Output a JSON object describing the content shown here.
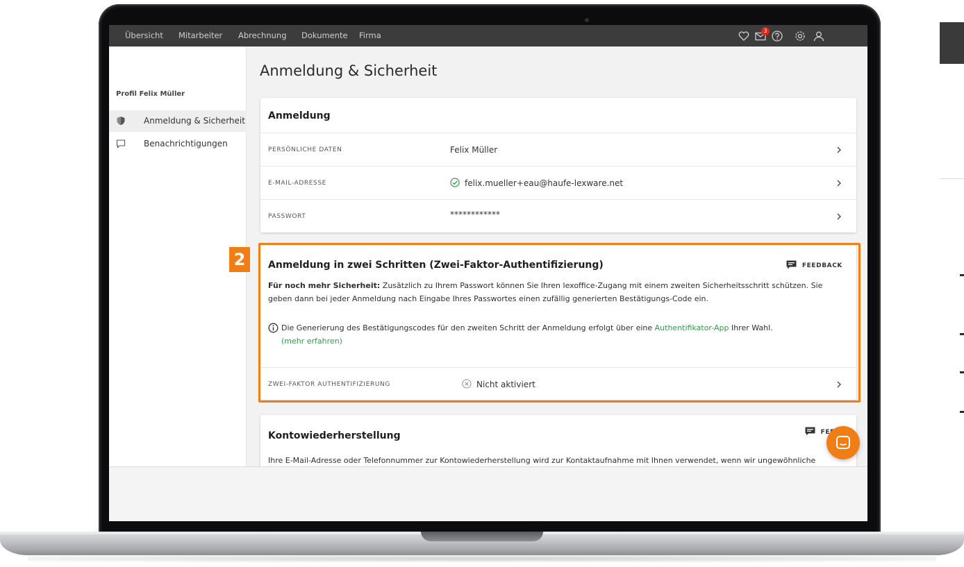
{
  "nav": {
    "items": [
      "Übersicht",
      "Mitarbeiter",
      "Abrechnung",
      "Dokumente",
      "Firma"
    ],
    "mail_badge": "3",
    "icons": [
      "heart-icon",
      "mail-icon",
      "help-icon",
      "gear-icon",
      "user-icon"
    ]
  },
  "sidebar": {
    "profile_label": "Profil Felix Müller",
    "items": [
      {
        "label": "Anmeldung & Sicherheit",
        "icon": "shield-icon",
        "active": true
      },
      {
        "label": "Benachrichtigungen",
        "icon": "chat-icon",
        "active": false
      }
    ]
  },
  "page": {
    "title": "Anmeldung & Sicherheit"
  },
  "login_card": {
    "title": "Anmeldung",
    "rows": [
      {
        "label": "PERSÖNLICHE DATEN",
        "value": "Felix Müller"
      },
      {
        "label": "E-MAIL-ADRESSE",
        "value": "felix.mueller+eau@haufe-lexware.net"
      },
      {
        "label": "PASSWORT",
        "value": "************"
      }
    ]
  },
  "twofa_card": {
    "badge": "2",
    "title": "Anmeldung in zwei Schritten (Zwei-Faktor-Authentifizierung)",
    "feedback_label": "FEEDBACK",
    "intro_bold": "Für noch mehr Sicherheit:",
    "intro_text": " Zusätzlich zu Ihrem Passwort können Sie Ihren lexoffice-Zugang mit einem zweiten Sicherheitsschritt schützen. Sie geben dann bei jeder Anmeldung nach Eingabe Ihres Passwortes einen zufällig generierten Bestätigungs-Code ein.",
    "info_text_before": "Die Generierung des Bestätigungscodes für den zweiten Schritt der Anmeldung erfolgt über eine ",
    "info_link": "Authentifikator-App",
    "info_text_after": " Ihrer Wahl.",
    "more_link": "(mehr erfahren)",
    "row_label": "ZWEI-FAKTOR AUTHENTIFIZIERUNG",
    "row_value": "Nicht aktiviert"
  },
  "recovery_card": {
    "title": "Kontowiederherstellung",
    "feedback_label": "FEEDBA",
    "text": "Ihre E-Mail-Adresse oder Telefonnummer zur Kontowiederherstellung wird zur Kontaktaufnahme mit Ihnen verwendet, wenn wir ungewöhnliche"
  },
  "colors": {
    "accent": "#f07e14",
    "nav_bg": "#3c3c3c",
    "success": "#2f9a4a",
    "badge_red": "#e1251b"
  }
}
